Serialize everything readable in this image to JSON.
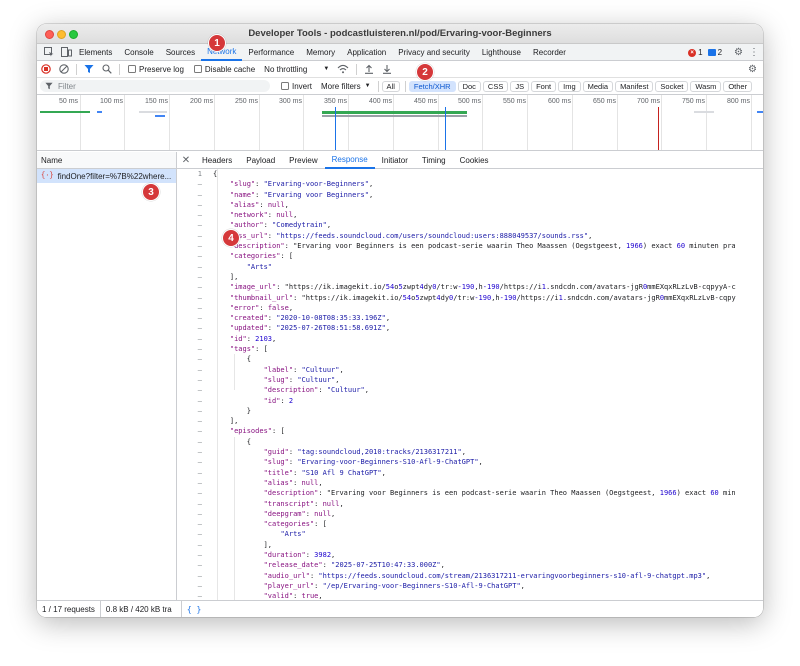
{
  "window": {
    "title": "Developer Tools - podcastluisteren.nl/pod/Ervaring-voor-Beginners"
  },
  "tabs": [
    "Elements",
    "Console",
    "Sources",
    "Network",
    "Performance",
    "Memory",
    "Application",
    "Privacy and security",
    "Lighthouse",
    "Recorder"
  ],
  "active_tab": "Network",
  "status_counts": {
    "errors": "1",
    "messages": "2"
  },
  "toolbar": {
    "preserve_log": "Preserve log",
    "disable_cache": "Disable cache",
    "throttling": "No throttling"
  },
  "filter": {
    "placeholder": "Filter",
    "invert": "Invert",
    "more_filters": "More filters",
    "chips": [
      "All",
      "Fetch/XHR",
      "Doc",
      "CSS",
      "JS",
      "Font",
      "Img",
      "Media",
      "Manifest",
      "Socket",
      "Wasm",
      "Other"
    ],
    "active_chip": "Fetch/XHR"
  },
  "timeline": {
    "ticks": [
      "50 ms",
      "100 ms",
      "150 ms",
      "200 ms",
      "250 ms",
      "300 ms",
      "350 ms",
      "400 ms",
      "450 ms",
      "500 ms",
      "550 ms",
      "600 ms",
      "650 ms",
      "700 ms",
      "750 ms",
      "800 ms"
    ]
  },
  "requests": {
    "header": "Name",
    "items": [
      "findOne?filter=%7B%22where..."
    ]
  },
  "detail_tabs": [
    "Headers",
    "Payload",
    "Preview",
    "Response",
    "Initiator",
    "Timing",
    "Cookies"
  ],
  "active_detail_tab": "Response",
  "response_lines": [
    "{",
    "    \"slug\": \"Ervaring-voor-Beginners\",",
    "    \"name\": \"Ervaring voor Beginners\",",
    "    \"alias\": null,",
    "    \"network\": null,",
    "    \"author\": \"Comedytrain\",",
    "    \"rss_url\": \"https://feeds.soundcloud.com/users/soundcloud:users:888049537/sounds.rss\",",
    "    \"description\": \"Ervaring voor Beginners is een podcast-serie waarin Theo Maassen (Oegstgeest, 1966) exact 60 minuten pra",
    "    \"categories\": [",
    "        \"Arts\"",
    "    ],",
    "    \"image_url\": \"https://ik.imagekit.io/54o5zwpt4dy0/tr:w-190,h-190/https://i1.sndcdn.com/avatars-jgR0mmEXqxRLzLvB-cqpyyA-c",
    "    \"thumbnail_url\": \"https://ik.imagekit.io/54o5zwpt4dy0/tr:w-190,h-190/https://i1.sndcdn.com/avatars-jgR0mmEXqxRLzLvB-cqpy",
    "    \"error\": false,",
    "    \"created\": \"2020-10-08T08:35:33.196Z\",",
    "    \"updated\": \"2025-07-26T08:51:58.691Z\",",
    "    \"id\": 2103,",
    "    \"tags\": [",
    "        {",
    "            \"label\": \"Cultuur\",",
    "            \"slug\": \"Cultuur\",",
    "            \"description\": \"Cultuur\",",
    "            \"id\": 2",
    "        }",
    "    ],",
    "    \"episodes\": [",
    "        {",
    "            \"guid\": \"tag:soundcloud,2010:tracks/2136317211\",",
    "            \"slug\": \"Ervaring-voor-Beginners-S10-Afl-9-ChatGPT\",",
    "            \"title\": \"S10 Afl 9 ChatGPT\",",
    "            \"alias\": null,",
    "            \"description\": \"Ervaring voor Beginners is een podcast-serie waarin Theo Maassen (Oegstgeest, 1966) exact 60 min",
    "            \"transcript\": null,",
    "            \"deepgram\": null,",
    "            \"categories\": [",
    "                \"Arts\"",
    "            ],",
    "            \"duration\": 3982,",
    "            \"release_date\": \"2025-07-25T10:47:33.000Z\",",
    "            \"audio_url\": \"https://feeds.soundcloud.com/stream/2136317211-ervaringvoorbeginners-s10-afl-9-chatgpt.mp3\",",
    "            \"player_url\": \"/ep/Ervaring-voor-Beginners-S10-Afl-9-ChatGPT\",",
    "            \"valid\": true,"
  ],
  "statusbar": {
    "requests": "1 / 17 requests",
    "transferred": "0.8 kB / 420 kB tra"
  },
  "callouts": [
    "1",
    "2",
    "3",
    "4"
  ]
}
